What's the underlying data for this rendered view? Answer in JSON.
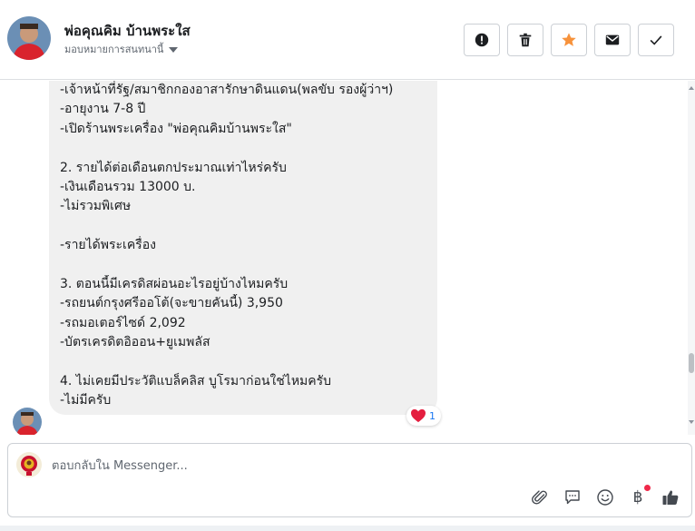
{
  "header": {
    "name": "พ่อคุณคิม บ้านพระใส",
    "assignment": "มอบหมายการสนทนานี้",
    "actions": [
      {
        "name": "report-button",
        "icon": "alert-icon"
      },
      {
        "name": "delete-button",
        "icon": "trash-icon"
      },
      {
        "name": "star-button",
        "icon": "star-icon"
      },
      {
        "name": "mark-unread-button",
        "icon": "envelope-icon"
      },
      {
        "name": "mark-done-button",
        "icon": "check-icon"
      }
    ]
  },
  "message": {
    "lines": [
      "-เจ้าหน้าที่รัฐ/สมาชิกกองอาสารักษาดินแดน(พลขับ รองผู้ว่าฯ)",
      "-อายุงาน 7-8 ปี",
      "-เปิดร้านพระเครื่อง \"พ่อคุณคิมบ้านพระใส\"",
      "",
      "2. รายได้ต่อเดือนตกประมาณเท่าไหร่ครับ",
      "-เงินเดือนรวม 13000 บ.",
      "-ไม่รวมพิเศษ",
      "",
      "-รายได้พระเครื่อง",
      "",
      "3. ตอนนี้มีเครดิสผ่อนอะไรอยู่บ้างไหมครับ",
      "-รถยนต์กรุงศรีออโต้(จะขายคันนี้) 3,950",
      "-รถมอเตอร์ไซด์ 2,092",
      "-บัตรเครดิตอิออน+ยูเมพลัส",
      "",
      "4. ไม่เคยมีประวัติแบล็คลิส บูโรมาก่อนใช่ไหมครับ",
      "-ไม่มีครับ"
    ],
    "reaction": {
      "icon": "heart-icon",
      "count": "1"
    }
  },
  "composer": {
    "placeholder": "ตอบกลับใน Messenger...",
    "tools": [
      "paperclip-icon",
      "saved-replies-icon",
      "emoji-icon",
      "baht-icon",
      "like-icon"
    ],
    "baht_symbol": "฿"
  },
  "colors": {
    "accent": "#1877f2",
    "star": "#f7923b",
    "heart": "#e41e3f",
    "bubble": "#f0f0f0"
  }
}
